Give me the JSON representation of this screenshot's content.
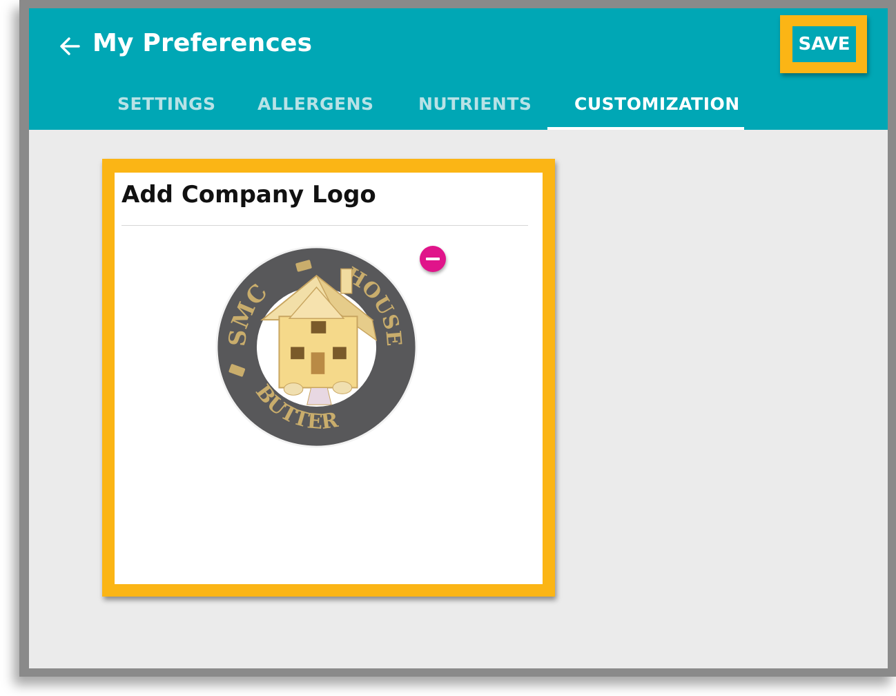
{
  "app": {
    "title": "My Preferences",
    "save_label": "SAVE"
  },
  "tabs": [
    {
      "label": "SETTINGS",
      "active": false
    },
    {
      "label": "ALLERGENS",
      "active": false
    },
    {
      "label": "NUTRIENTS",
      "active": false
    },
    {
      "label": "CUSTOMIZATION",
      "active": true
    }
  ],
  "card": {
    "title": "Add Company Logo",
    "logo": {
      "top_text": "SMC",
      "bottom_text": "BUTTERHOUSE"
    }
  },
  "colors": {
    "appbar": "#00a7b5",
    "highlight": "#fbb515",
    "remove_button": "#e0148a",
    "background": "#ebebeb"
  },
  "icons": {
    "back": "arrow-left-icon",
    "remove": "minus-circle-icon"
  }
}
